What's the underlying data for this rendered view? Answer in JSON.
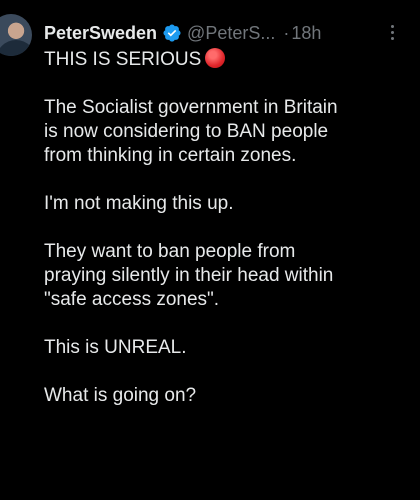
{
  "tweet": {
    "author": {
      "display_name": "PeterSweden",
      "handle": "@PeterS...",
      "verified_icon": "verified-badge-icon",
      "avatar_icon": "avatar"
    },
    "separator": "·",
    "time": "18h",
    "more_icon": "more-options-icon",
    "text": {
      "headline": "THIS IS SERIOUS",
      "headline_emoji": "red-circle-emoji",
      "paragraph1": [
        "The Socialist government in Britain",
        "is now considering to BAN people",
        "from thinking in certain zones."
      ],
      "paragraph2": "I'm not making this up.",
      "paragraph3": [
        "They want to ban people from",
        "praying silently in their head within",
        "\"safe access zones\"."
      ],
      "paragraph4": "This is UNREAL.",
      "paragraph5": "What is going on?"
    },
    "colors": {
      "background": "#000000",
      "text": "#e7e9ea",
      "muted": "#71767b",
      "verified": "#1d9bf0",
      "red_circle": "#e0262b"
    }
  }
}
